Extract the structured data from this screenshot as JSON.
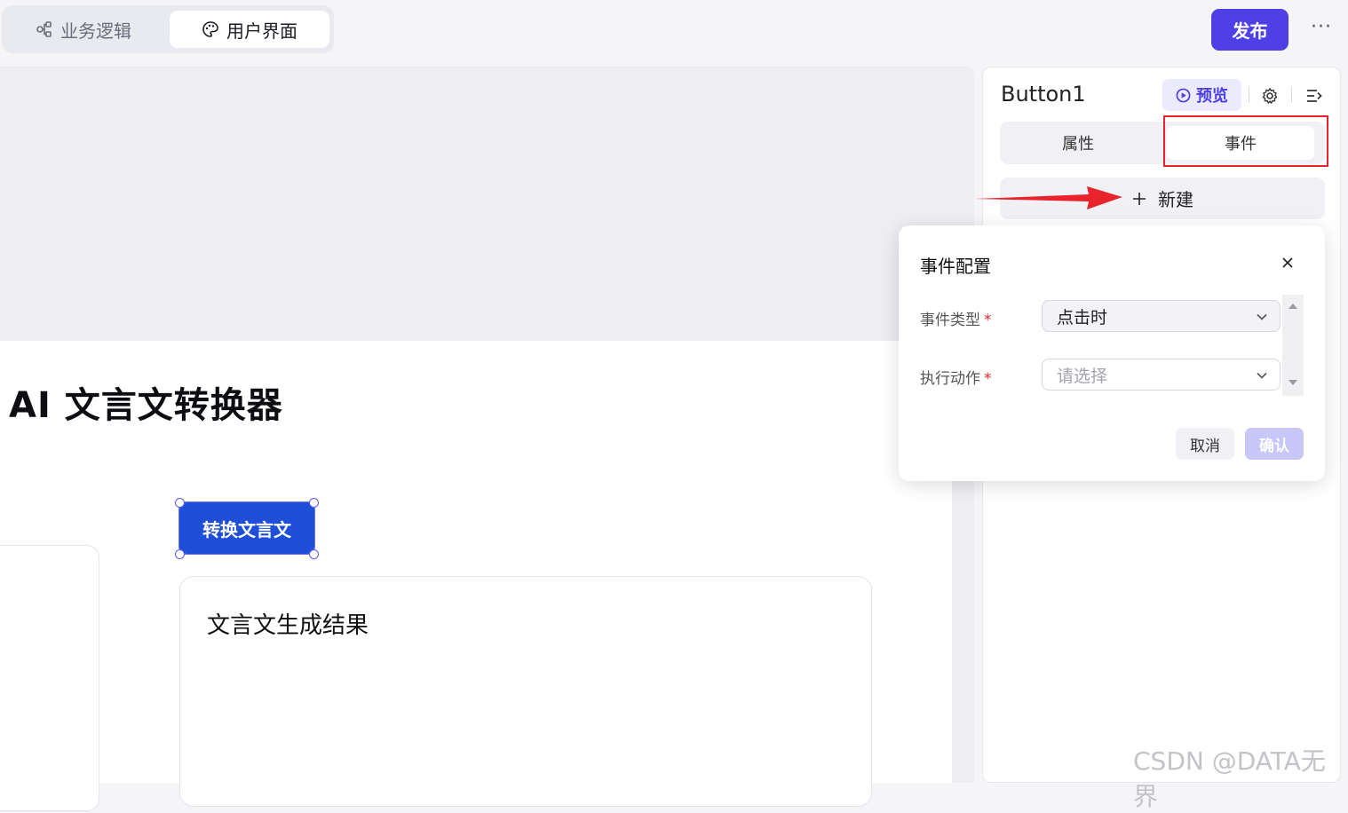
{
  "topbar": {
    "tabs": [
      {
        "label": "业务逻辑",
        "icon": "nodes-icon"
      },
      {
        "label": "用户界面",
        "icon": "palette-icon"
      }
    ],
    "publish_label": "发布",
    "more_label": "···"
  },
  "canvas": {
    "page_title": "AI 文言文转换器",
    "convert_button_label": "转换文言文",
    "result_title": "文言文生成结果"
  },
  "panel": {
    "component_name": "Button1",
    "preview_label": "预览",
    "tabs": [
      {
        "label": "属性"
      },
      {
        "label": "事件"
      }
    ],
    "new_label": "新建"
  },
  "event_config": {
    "title": "事件配置",
    "fields": [
      {
        "label": "事件类型",
        "required_mark": "*",
        "value": "点击时"
      },
      {
        "label": "执行动作",
        "required_mark": "*",
        "placeholder": "请选择"
      }
    ],
    "cancel_label": "取消",
    "confirm_label": "确认"
  },
  "watermark": "CSDN @DATA无界",
  "colors": {
    "accent": "#4e40e5",
    "button_blue": "#1f4ed8",
    "annotation_red": "#e8232b"
  }
}
